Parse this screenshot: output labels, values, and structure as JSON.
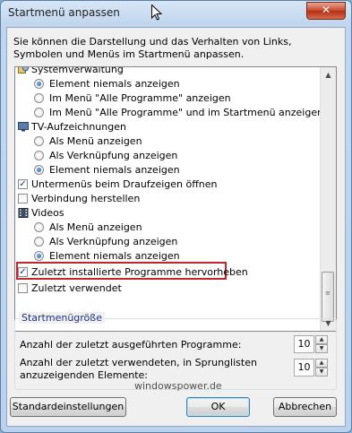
{
  "window": {
    "title": "Startmenü anpassen",
    "close_glyph": "✕"
  },
  "intro": "Sie können die Darstellung und das Verhalten von Links, Symbolen und Menüs im Startmenü anpassen.",
  "list": {
    "admin": {
      "label": "Systemverwaltung",
      "options": [
        "Element niemals anzeigen",
        "Im Menü \"Alle Programme\" anzeigen",
        "Im Menü \"Alle Programme\" und im Startmenü anzeigen"
      ],
      "selected": 0
    },
    "tv": {
      "label": "TV-Aufzeichnungen",
      "options": [
        "Als Menü anzeigen",
        "Als Verknüpfung anzeigen",
        "Element niemals anzeigen"
      ],
      "selected": 2
    },
    "submenus": {
      "label": "Untermenüs beim Draufzeigen öffnen",
      "checked": true
    },
    "connect": {
      "label": "Verbindung herstellen",
      "checked": false
    },
    "videos": {
      "label": "Videos",
      "options": [
        "Als Menü anzeigen",
        "Als Verknüpfung anzeigen",
        "Element niemals anzeigen"
      ],
      "selected": 2
    },
    "highlight": {
      "label": "Zuletzt installierte Programme hervorheben",
      "checked": true
    },
    "recent": {
      "label": "Zuletzt verwendet",
      "checked": false
    }
  },
  "size_group": {
    "title": "Startmenügröße",
    "recent_programs": {
      "label": "Anzahl der zuletzt ausgeführten Programme:",
      "value": "10"
    },
    "jumplist": {
      "label": "Anzahl der zuletzt verwendeten, in Sprunglisten anzuzeigenden Elemente:",
      "value": "10"
    }
  },
  "watermark": "windowspower.de",
  "buttons": {
    "defaults": "Standardeinstellungen",
    "ok": "OK",
    "cancel": "Abbrechen"
  },
  "icons": {
    "check": "✓",
    "scroll_up": "▲",
    "scroll_down": "▼",
    "spin_up": "▲",
    "spin_down": "▼",
    "grip": "≡"
  },
  "colors": {
    "highlight_border": "#c0272d",
    "groupbox_title": "#1e3287",
    "close_button": "#c9462c"
  }
}
